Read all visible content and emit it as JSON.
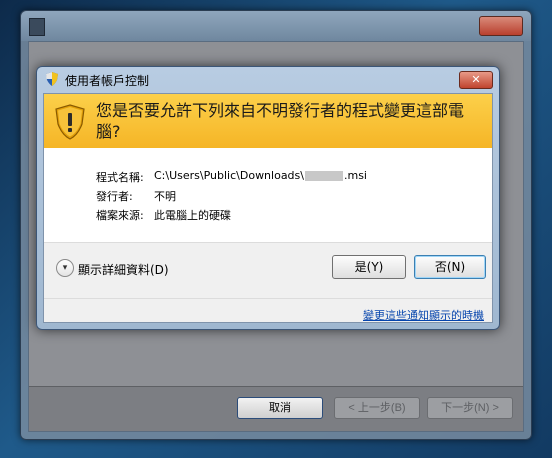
{
  "background_window": {
    "cancel_label": "取消",
    "back_label": "< 上一步(B)",
    "next_label": "下一步(N) >"
  },
  "dialog": {
    "title": "使用者帳戶控制",
    "close_glyph": "✕",
    "question": "您是否要允許下列來自不明發行者的程式變更這部電腦?",
    "details": {
      "program_label": "程式名稱:",
      "program_value_prefix": "C:\\Users\\Public\\Downloads\\",
      "program_value_suffix": ".msi",
      "publisher_label": "發行者:",
      "publisher_value": "不明",
      "source_label": "檔案來源:",
      "source_value": "此電腦上的硬碟"
    },
    "show_details_label": "顯示詳細資料(D)",
    "yes_label": "是(Y)",
    "no_label": "否(N)",
    "notification_link": "變更這些通知顯示的時機"
  },
  "icons": {
    "title_icon": "shield-icon",
    "header_icon": "warning-shield-icon",
    "toggle_icon": "chevron-down-icon"
  },
  "colors": {
    "header_band": "#f5b526",
    "link": "#0645ad"
  }
}
